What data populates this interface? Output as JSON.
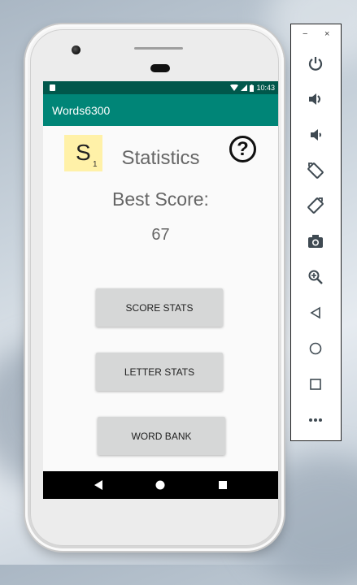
{
  "status_bar": {
    "time": "10:43"
  },
  "app_bar": {
    "title": "Words6300"
  },
  "tile": {
    "letter": "S",
    "points": "1"
  },
  "screen": {
    "title": "Statistics",
    "help_glyph": "?",
    "best_score_label": "Best Score:",
    "best_score_value": "67"
  },
  "buttons": {
    "score_stats": "SCORE STATS",
    "letter_stats": "LETTER STATS",
    "word_bank": "WORD BANK"
  },
  "nav": {
    "back": "back-icon",
    "home": "home-icon",
    "recents": "recents-icon"
  },
  "emulator_toolbar": {
    "minimize": "−",
    "close": "×",
    "icons": [
      "power-icon",
      "volume-up-icon",
      "volume-down-icon",
      "rotate-left-icon",
      "rotate-right-icon",
      "camera-icon",
      "zoom-icon",
      "back-icon",
      "home-icon",
      "overview-icon",
      "more-icon"
    ]
  },
  "colors": {
    "status_bar": "#00574b",
    "app_bar": "#008577",
    "tile": "#fff1a8",
    "button": "#d6d7d7"
  }
}
